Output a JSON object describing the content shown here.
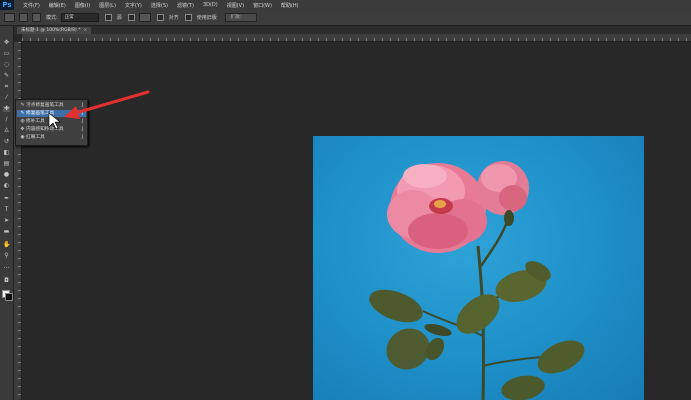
{
  "app": {
    "logo": "Ps"
  },
  "menu": [
    "文件(F)",
    "编辑(E)",
    "图像(I)",
    "图层(L)",
    "文字(Y)",
    "选择(S)",
    "滤镜(T)",
    "3D(D)",
    "视图(V)",
    "窗口(W)",
    "帮助(H)"
  ],
  "options": {
    "mode_label": "模式:",
    "mode_value": "正常",
    "source_label": "源",
    "pattern_label": "图案",
    "aligned_label": "对齐",
    "sample_label": "使用旧版",
    "diffusion_label": "扩散:"
  },
  "document": {
    "tab_title": "未标题-1 @ 100%(RGB/8) *",
    "close": "×"
  },
  "flyout": {
    "items": [
      {
        "icon": "spot-healing-brush-icon",
        "label": "污点修复画笔工具",
        "key": "J"
      },
      {
        "icon": "healing-brush-icon",
        "label": "修复画笔工具",
        "key": "J"
      },
      {
        "icon": "patch-icon",
        "label": "修补工具",
        "key": "J"
      },
      {
        "icon": "content-aware-move-icon",
        "label": "内容感知移动工具",
        "key": "J"
      },
      {
        "icon": "red-eye-icon",
        "label": "红眼工具",
        "key": "J"
      }
    ],
    "selected_index": 1
  },
  "colors": {
    "accent": "#3c6fa8",
    "arrow": "#e53030",
    "photo_bg": "#1e8fc8"
  }
}
